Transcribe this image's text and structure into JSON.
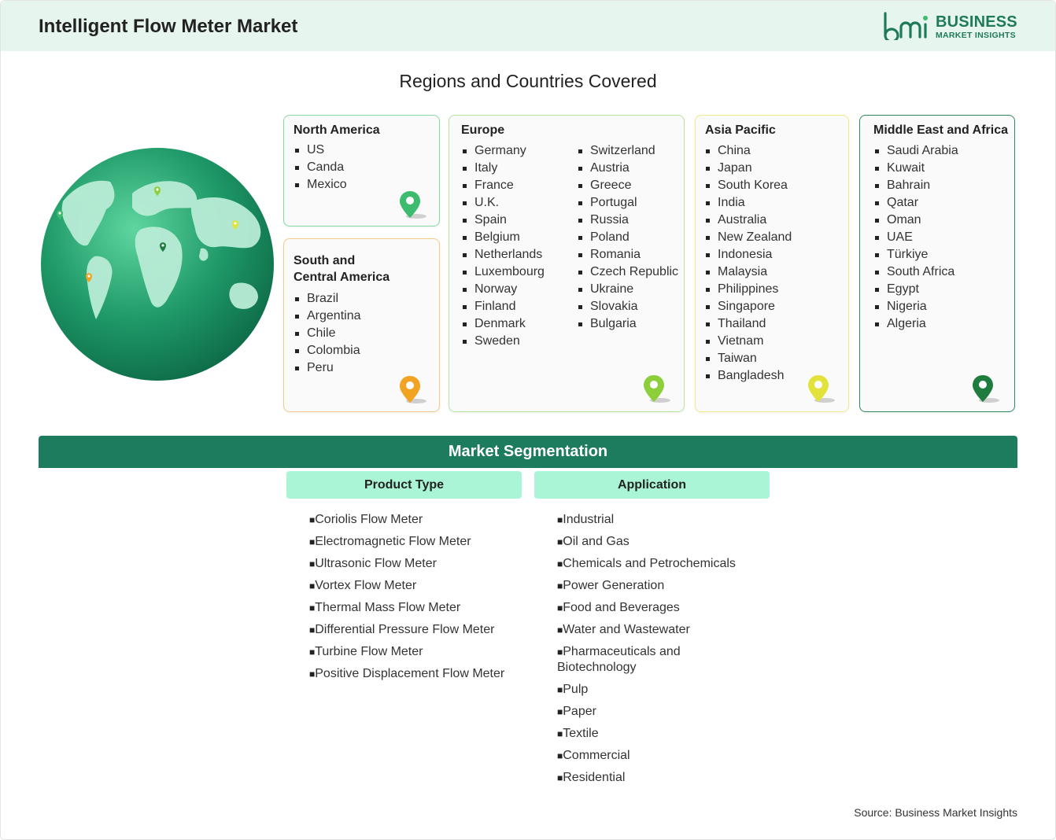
{
  "header": {
    "title": "Intelligent Flow Meter Market"
  },
  "logo": {
    "line1": "BUSINESS",
    "line2": "MARKET INSIGHTS",
    "mark": "bmi"
  },
  "subtitle": "Regions and Countries Covered",
  "regions": {
    "north_america": {
      "title": "North America",
      "countries": [
        "US",
        "Canda",
        "Mexico"
      ]
    },
    "south_central_america": {
      "title_line1": "South and",
      "title_line2": "Central America",
      "countries": [
        "Brazil",
        "Argentina",
        "Chile",
        "Colombia",
        "Peru"
      ]
    },
    "europe": {
      "title": "Europe",
      "countries_col1": [
        "Germany",
        "Italy",
        "France",
        "U.K.",
        "Spain",
        "Belgium",
        "Netherlands",
        "Luxembourg",
        "Norway",
        "Finland",
        "Denmark",
        "Sweden"
      ],
      "countries_col2": [
        "Switzerland",
        "Austria",
        "Greece",
        "Portugal",
        "Russia",
        "Poland",
        "Romania",
        "Czech Republic",
        "Ukraine",
        "Slovakia",
        "Bulgaria"
      ]
    },
    "asia_pacific": {
      "title": "Asia Pacific",
      "countries": [
        "China",
        "Japan",
        "South Korea",
        "India",
        "Australia",
        "New Zealand",
        "Indonesia",
        "Malaysia",
        "Philippines",
        "Singapore",
        "Thailand",
        "Vietnam",
        "Taiwan",
        "Bangladesh"
      ]
    },
    "middle_east_africa": {
      "title": "Middle East and Africa",
      "countries": [
        "Saudi Arabia",
        "Kuwait",
        "Bahrain",
        "Qatar",
        "Oman",
        "UAE",
        "Türkiye",
        "South Africa",
        "Egypt",
        "Nigeria",
        "Algeria"
      ]
    }
  },
  "segmentation": {
    "title": "Market Segmentation",
    "product_type": {
      "title": "Product Type",
      "items": [
        "Coriolis Flow Meter",
        "Electromagnetic Flow Meter",
        "Ultrasonic Flow Meter",
        "Vortex Flow Meter",
        "Thermal Mass Flow Meter",
        "Differential Pressure Flow Meter",
        "Turbine Flow Meter",
        "Positive Displacement Flow Meter"
      ]
    },
    "application": {
      "title": "Application",
      "items": [
        "Industrial",
        "Oil and Gas",
        "Chemicals and Petrochemicals",
        "Power Generation",
        "Food and Beverages",
        "Water and Wastewater",
        "Pharmaceuticals and Biotechnology",
        "Pulp",
        "Paper",
        "Textile",
        "Commercial",
        "Residential"
      ]
    }
  },
  "source": "Source: Business Market Insights",
  "colors": {
    "na_border": "#86d9a6",
    "sca_border": "#f5c98a",
    "eu_border": "#b9e3a0",
    "ap_border": "#f1ea8a",
    "mea_border": "#2e8a5e",
    "na_pin": "#3dbb6e",
    "sca_pin": "#f2a322",
    "eu_pin": "#8ccf3a",
    "ap_pin": "#e2e23a",
    "mea_pin": "#1e7c3e",
    "seg_bar": "#1e7c5e",
    "seg_head": "#aaf5d6",
    "header_bg": "#e6f6ee"
  },
  "icons": [
    "globe-icon",
    "location-pin-icon",
    "bmi-logo-icon"
  ]
}
